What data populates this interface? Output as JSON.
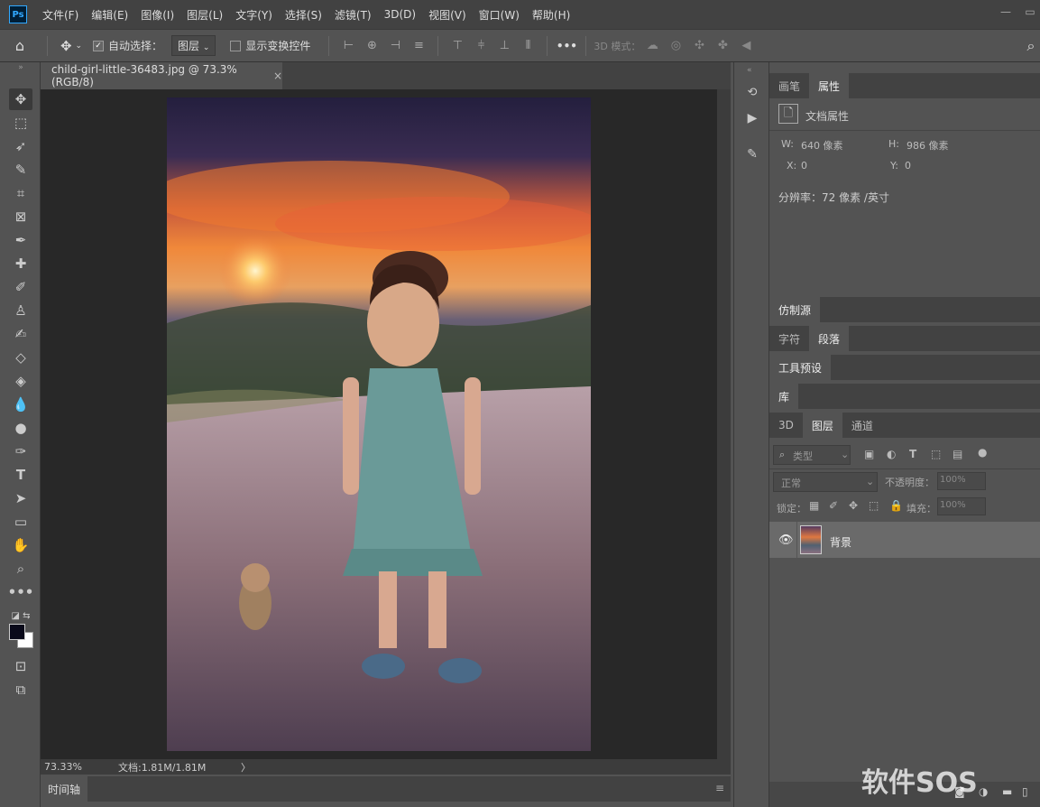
{
  "app": {
    "logo": "Ps",
    "document_title": "child-girl-little-36483.jpg @ 73.3%(RGB/8)",
    "close_glyph": "×"
  },
  "menu": [
    "文件(F)",
    "编辑(E)",
    "图像(I)",
    "图层(L)",
    "文字(Y)",
    "选择(S)",
    "滤镜(T)",
    "3D(D)",
    "视图(V)",
    "窗口(W)",
    "帮助(H)"
  ],
  "options": {
    "auto_select_label": "自动选择：",
    "auto_select_target": "图层",
    "show_transform_label": "显示变换控件",
    "mode_3d_label": "3D 模式：",
    "more_label": "•••"
  },
  "status": {
    "zoom": "73.33%",
    "doc_size": "文档:1.81M/1.81M",
    "arrow": "〉"
  },
  "timeline": {
    "label": "时间轴"
  },
  "properties_panel": {
    "tabs": [
      "画笔",
      "属性"
    ],
    "active_tab": "属性",
    "section_title": "文档属性",
    "w_label": "W:",
    "w_value": "640 像素",
    "h_label": "H:",
    "h_value": "986 像素",
    "x_label": "X:",
    "x_value": "0",
    "y_label": "Y:",
    "y_value": "0",
    "resolution": "分辨率：72 像素 /英寸"
  },
  "collapsed_panels": {
    "clone_source": "仿制源",
    "character": "字符",
    "paragraph": "段落",
    "tool_presets": "工具预设",
    "library": "库"
  },
  "layers_panel": {
    "tabs": [
      "3D",
      "图层",
      "通道"
    ],
    "active_tab": "图层",
    "filter_kind": "类型",
    "blend_mode": "正常",
    "opacity_label": "不透明度：",
    "opacity_value": "100%",
    "lock_label": "锁定：",
    "fill_label": "填充：",
    "fill_value": "100%",
    "layers": [
      {
        "name": "背景",
        "visible": true
      }
    ]
  },
  "watermark": "软件SOS",
  "colors": {
    "accent": "#31a8ff",
    "bg": "#535353",
    "dark": "#424242",
    "canvas": "#282828"
  }
}
